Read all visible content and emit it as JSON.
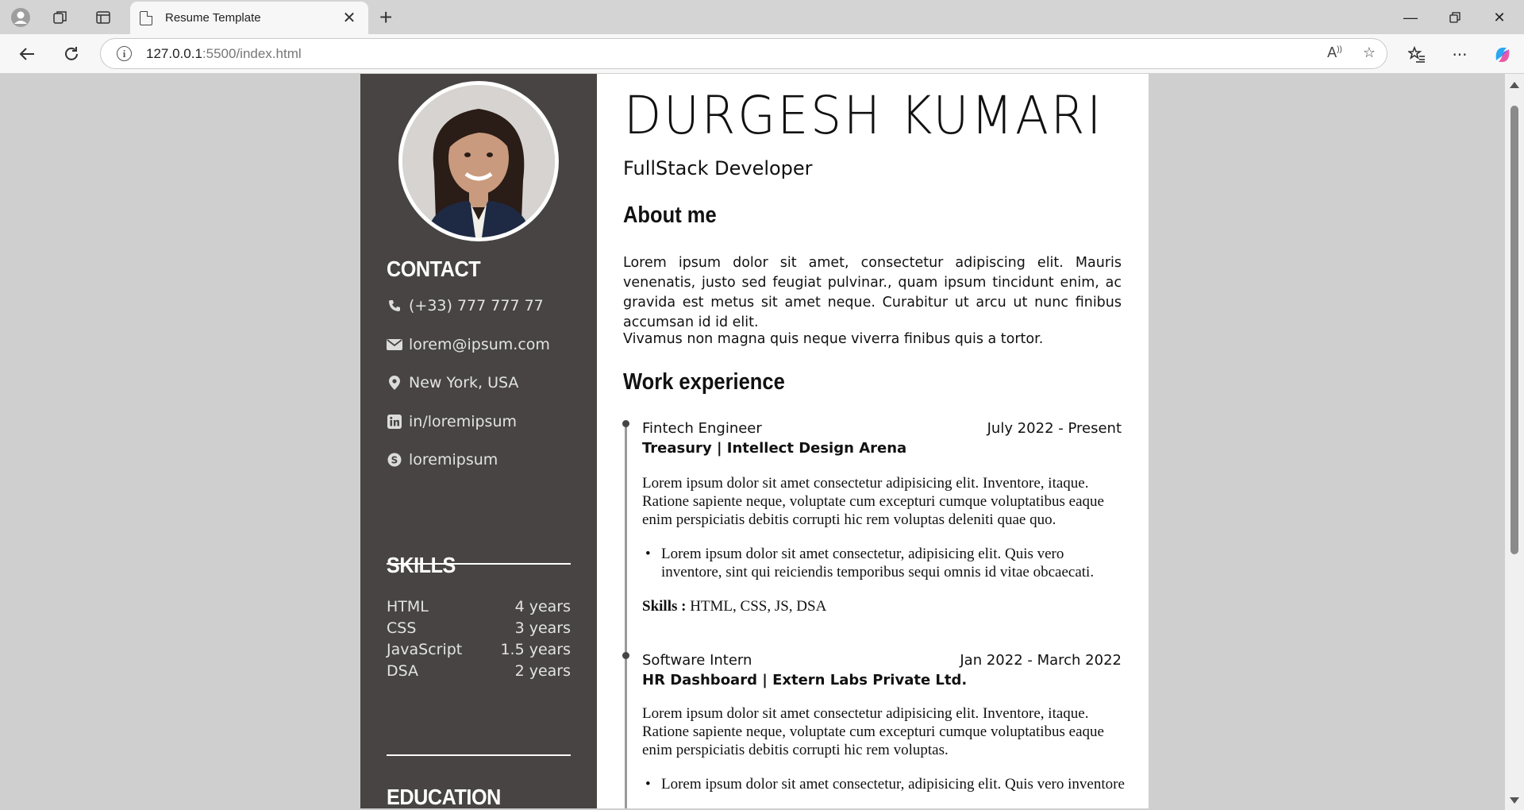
{
  "browser": {
    "tab_title": "Resume Template",
    "url_host": "127.0.0.1",
    "url_path": ":5500/index.html"
  },
  "resume": {
    "name": "DURGESH KUMARI",
    "role": "FullStack Developer",
    "contact": {
      "title": "CONTACT",
      "phone": "(+33) 777 777 77",
      "email": "lorem@ipsum.com",
      "location": "New York, USA",
      "linkedin": "in/loremipsum",
      "skype": "loremipsum"
    },
    "skills": {
      "title": "SKILLS",
      "items": [
        {
          "name": "HTML",
          "years": "4 years"
        },
        {
          "name": "CSS",
          "years": "3 years"
        },
        {
          "name": "JavaScript",
          "years": "1.5 years"
        },
        {
          "name": "DSA",
          "years": "2 years"
        }
      ]
    },
    "education": {
      "title": "EDUCATION"
    },
    "about": {
      "title": "About me",
      "p1": "Lorem ipsum dolor sit amet, consectetur adipiscing elit. Mauris venenatis, justo sed feugiat pulvinar., quam ipsum tincidunt enim, ac gravida est metus sit amet neque. Curabitur ut arcu ut nunc finibus accumsan id id elit.",
      "p2": "Vivamus non magna quis neque viverra finibus quis a tortor."
    },
    "work": {
      "title": "Work experience",
      "jobs": [
        {
          "title": "Fintech Engineer",
          "date": "July 2022 - Present",
          "company": "Treasury | Intellect Design Arena",
          "desc": "Lorem ipsum dolor sit amet consectetur adipisicing elit. Inventore, itaque. Ratione sapiente neque, voluptate cum excepturi cumque voluptatibus eaque enim perspiciatis debitis corrupti hic rem voluptas deleniti quae quo.",
          "bullet": "Lorem ipsum dolor sit amet consectetur, adipisicing elit. Quis vero inventore, sint qui reiciendis temporibus sequi omnis id vitae obcaecati.",
          "skills_label": "Skills :",
          "skills": " HTML, CSS, JS, DSA"
        },
        {
          "title": "Software Intern",
          "date": "Jan 2022 - March 2022",
          "company": "HR Dashboard | Extern Labs Private Ltd.",
          "desc": "Lorem ipsum dolor sit amet consectetur adipisicing elit. Inventore, itaque. Ratione sapiente neque, voluptate cum excepturi cumque voluptatibus eaque enim perspiciatis debitis corrupti hic rem voluptas.",
          "bullet": "Lorem ipsum dolor sit amet consectetur, adipisicing elit. Quis vero inventore"
        }
      ]
    }
  }
}
